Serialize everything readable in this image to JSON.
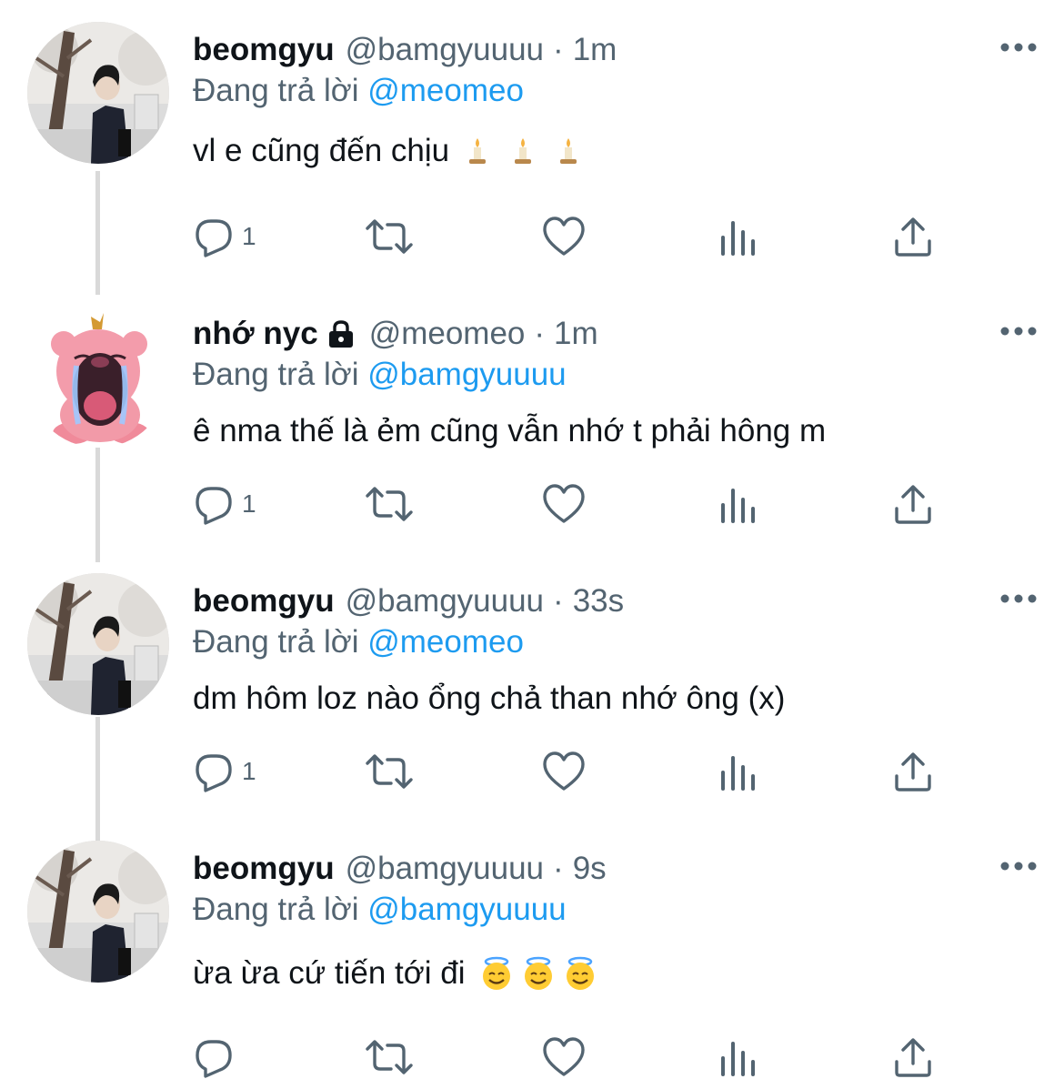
{
  "thread": {
    "tweets": [
      {
        "name": "beomgyu",
        "locked": false,
        "handle": "@bamgyuuuu",
        "separator": "·",
        "time": "1m",
        "reply_prefix": "Đang trả lời",
        "reply_to": "@meomeo",
        "text": "vl e cũng đến chịu",
        "emoji_icons": [
          "candle-icon",
          "candle-icon",
          "candle-icon"
        ],
        "reply_count": "1",
        "avatar": "beomgyu-avatar"
      },
      {
        "name": "nhớ nyc",
        "locked": true,
        "handle": "@meomeo",
        "separator": "·",
        "time": "1m",
        "reply_prefix": "Đang trả lời",
        "reply_to": "@bamgyuuuu",
        "text": "ê nma thế là ẻm cũng vẫn nhớ t phải hông m",
        "emoji_icons": [],
        "reply_count": "1",
        "avatar": "pink-beaver-avatar"
      },
      {
        "name": "beomgyu",
        "locked": false,
        "handle": "@bamgyuuuu",
        "separator": "·",
        "time": "33s",
        "reply_prefix": "Đang trả lời",
        "reply_to": "@meomeo",
        "text": "dm hôm loz nào ổng chả than nhớ ông (x)",
        "emoji_icons": [],
        "reply_count": "1",
        "avatar": "beomgyu-avatar"
      },
      {
        "name": "beomgyu",
        "locked": false,
        "handle": "@bamgyuuuu",
        "separator": "·",
        "time": "9s",
        "reply_prefix": "Đang trả lời",
        "reply_to": "@bamgyuuuu",
        "text": "ừa ừa cứ tiến tới đi",
        "emoji_icons": [
          "halo-smile-emoji",
          "halo-smile-emoji",
          "halo-smile-emoji"
        ],
        "reply_count": "",
        "avatar": "beomgyu-avatar"
      }
    ]
  },
  "colors": {
    "text": "#0f1419",
    "secondary": "#536471",
    "mention": "#1d9bf0",
    "thread_line": "#d9d9d9"
  }
}
